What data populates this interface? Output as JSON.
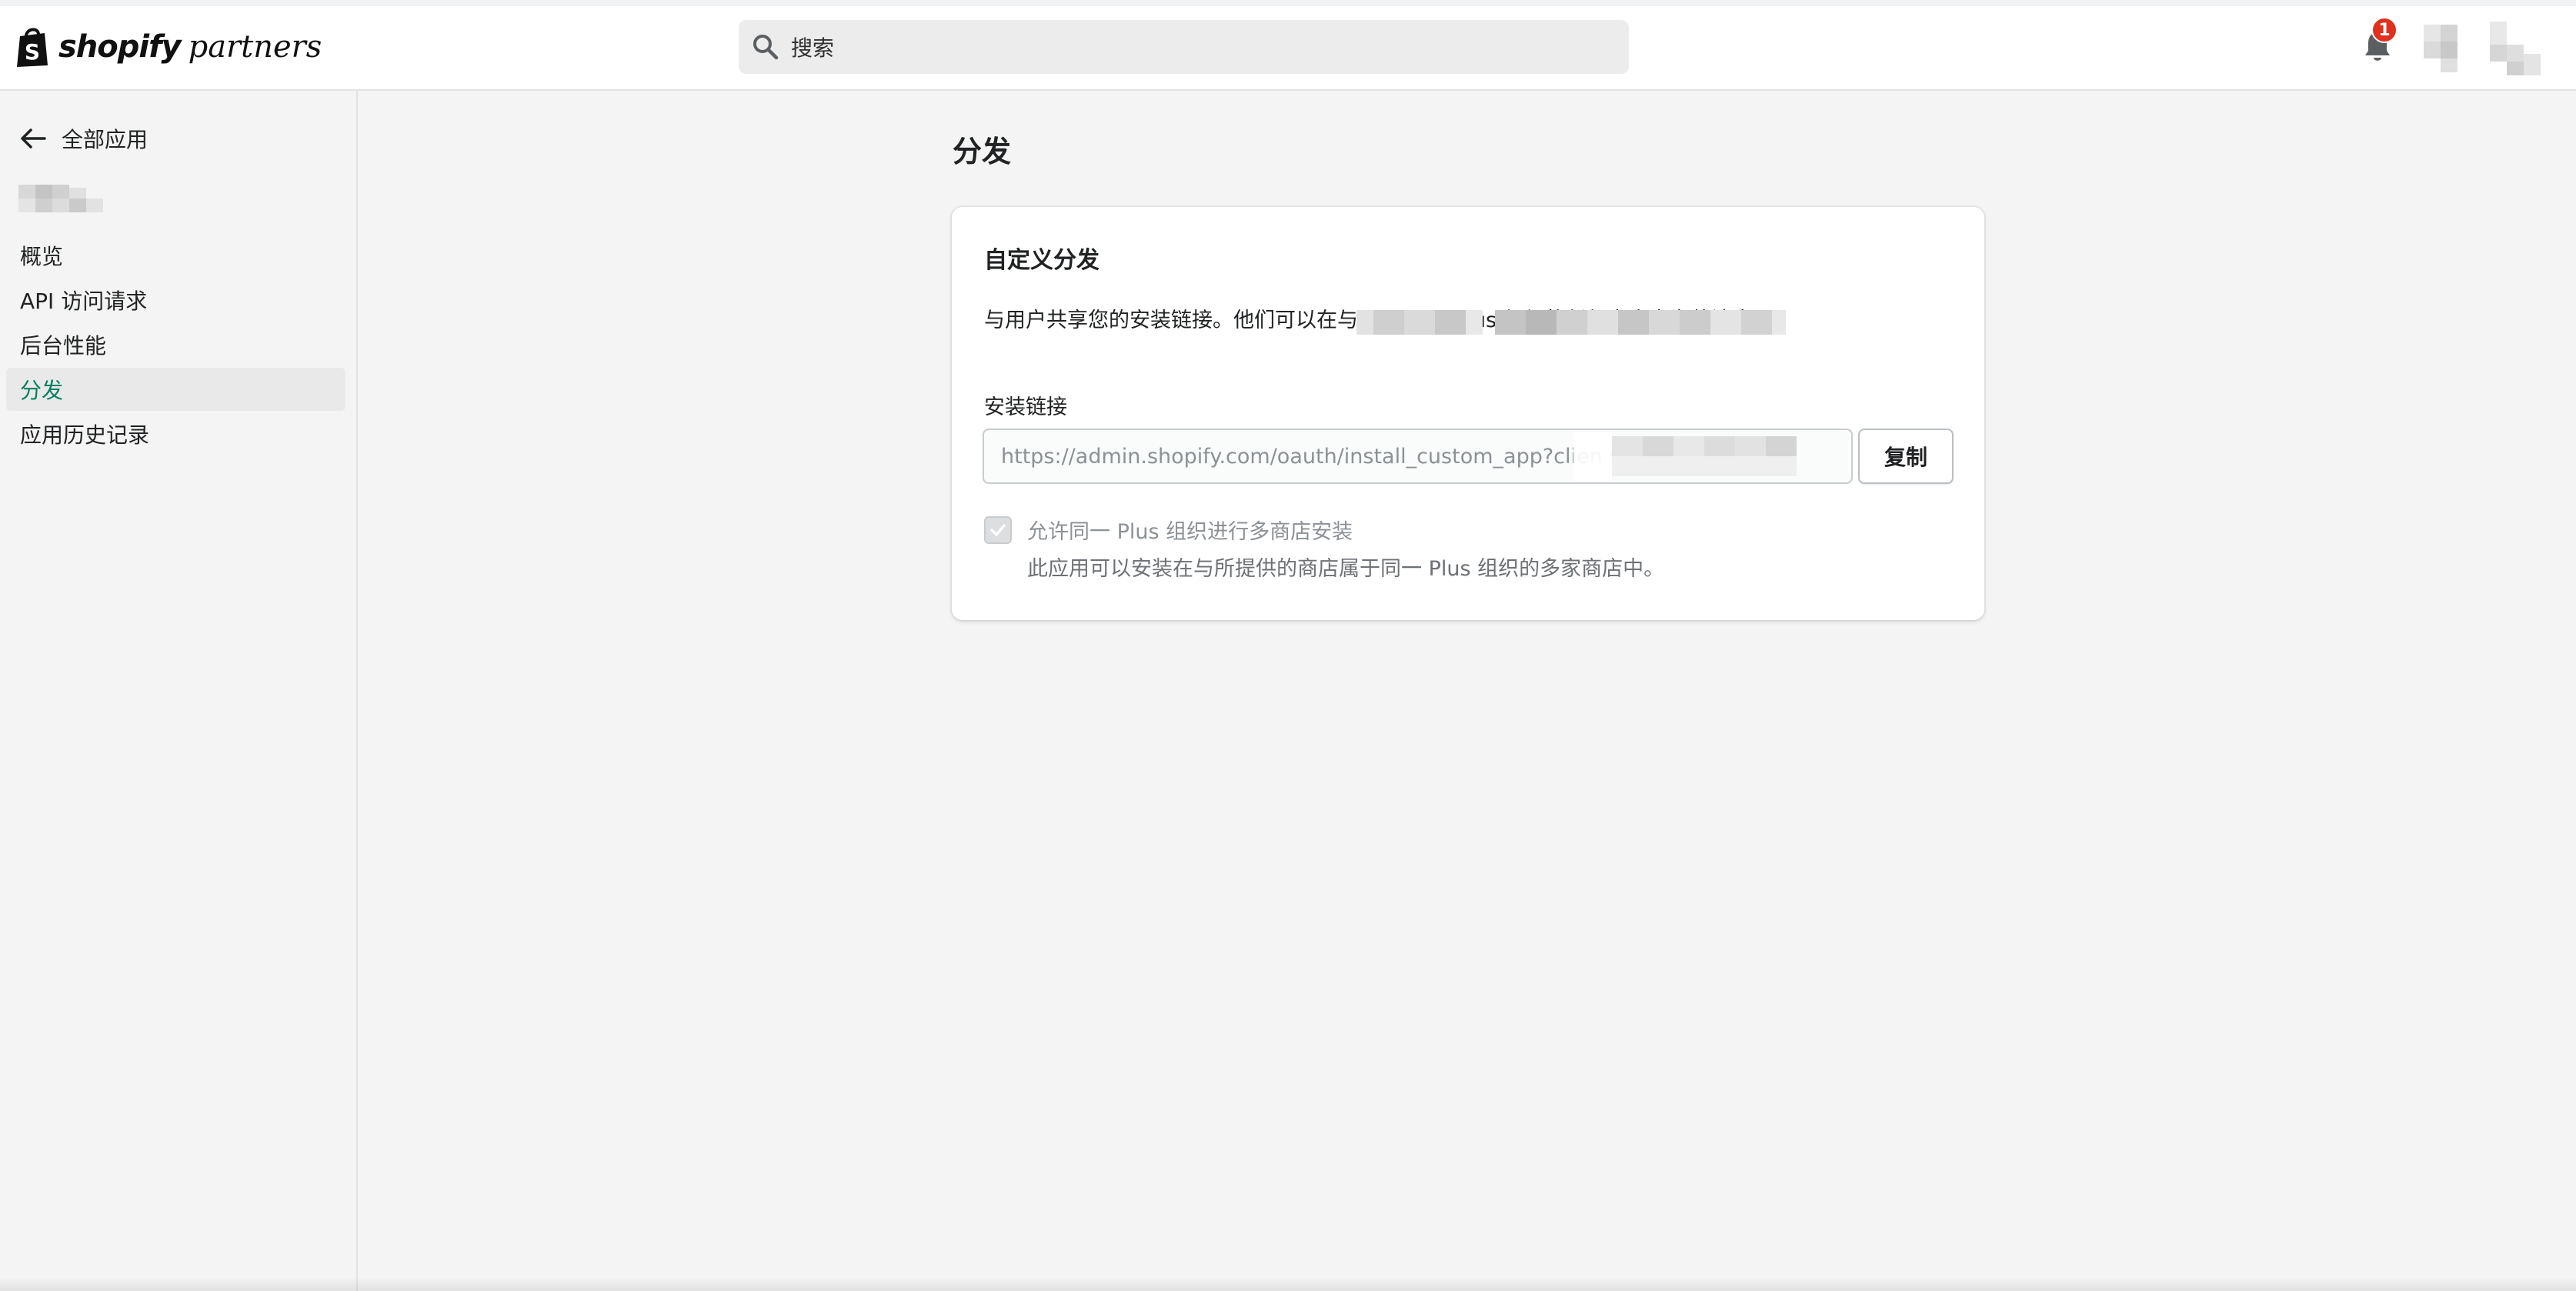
{
  "topbar": {
    "logo_word": "shopify",
    "logo_suffix": "partners",
    "search_placeholder": "搜索",
    "notification_count": "1"
  },
  "sidebar": {
    "back_label": "全部应用",
    "items": [
      {
        "label": "概览",
        "active": false
      },
      {
        "label": "API 访问请求",
        "active": false
      },
      {
        "label": "后台性能",
        "active": false
      },
      {
        "label": "分发",
        "active": true
      },
      {
        "label": "应用历史记录",
        "active": false
      }
    ]
  },
  "main": {
    "page_title": "分发",
    "card": {
      "title": "自定义分发",
      "description": "与用户共享您的安装链接。他们可以在与                                                                属于同一 Plus 组织的任何商店中安装该应用。",
      "install_link_label": "安装链接",
      "install_link_value": "https://admin.shopify.com/oauth/install_custom_app?clien                                        9ec",
      "copy_label": "复制",
      "checkbox_label": "允许同一 Plus 组织进行多商店安装",
      "checkbox_checked": true,
      "checkbox_help": "此应用可以安装在与所提供的商店属于同一 Plus 组织的多家商店中。"
    }
  },
  "colors": {
    "accent_green": "#008060",
    "badge_red": "#e0301e",
    "background": "#f4f4f4"
  }
}
